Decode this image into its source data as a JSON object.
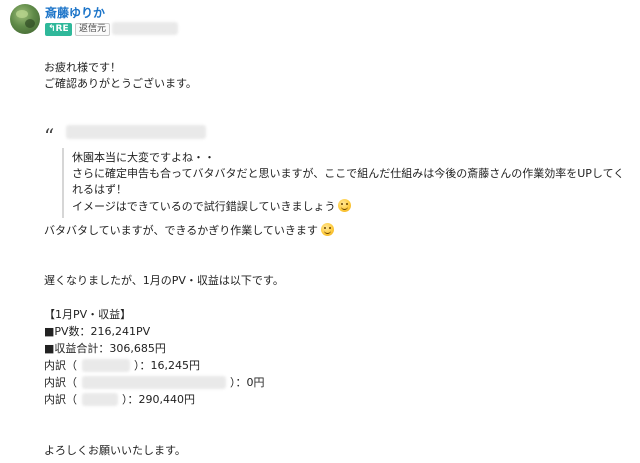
{
  "header": {
    "sender_name": "斎藤ゆりか",
    "re_label": "↰RE",
    "tag_label": "返信元"
  },
  "body": {
    "greeting": "お疲れ様です！",
    "thanks": "ご確認ありがとうございます。",
    "quote_mark": "“",
    "quote": {
      "line1": "休園本当に大変ですよね・・",
      "line2": "さらに確定申告も合ってバタバタだと思いますが、ここで組んだ仕組みは今後の斎藤さんの作業効率をUPしてく",
      "line3": "れるはず！",
      "line4": "イメージはできているので試行錯誤していきましょう"
    },
    "reply_line": "バタバタしていますが、できるかぎり作業していきます",
    "report_intro": "遅くなりましたが、1月のPV・収益は以下です。",
    "report_title": "【1月PV・収益】",
    "pv": "■PV数：216,241PV",
    "revenue_total": "■収益合計：306,685円",
    "breakdown": [
      {
        "label": "内訳（",
        "close": "）：16,245円"
      },
      {
        "label": "内訳（",
        "close": "）：0円"
      },
      {
        "label": "内訳（",
        "close": "）：290,440円"
      }
    ],
    "closing": "よろしくお願いいたします。"
  },
  "icons": {
    "emoji_quote": "grinning-face-icon",
    "emoji_reply": "smiling-face-icon"
  }
}
